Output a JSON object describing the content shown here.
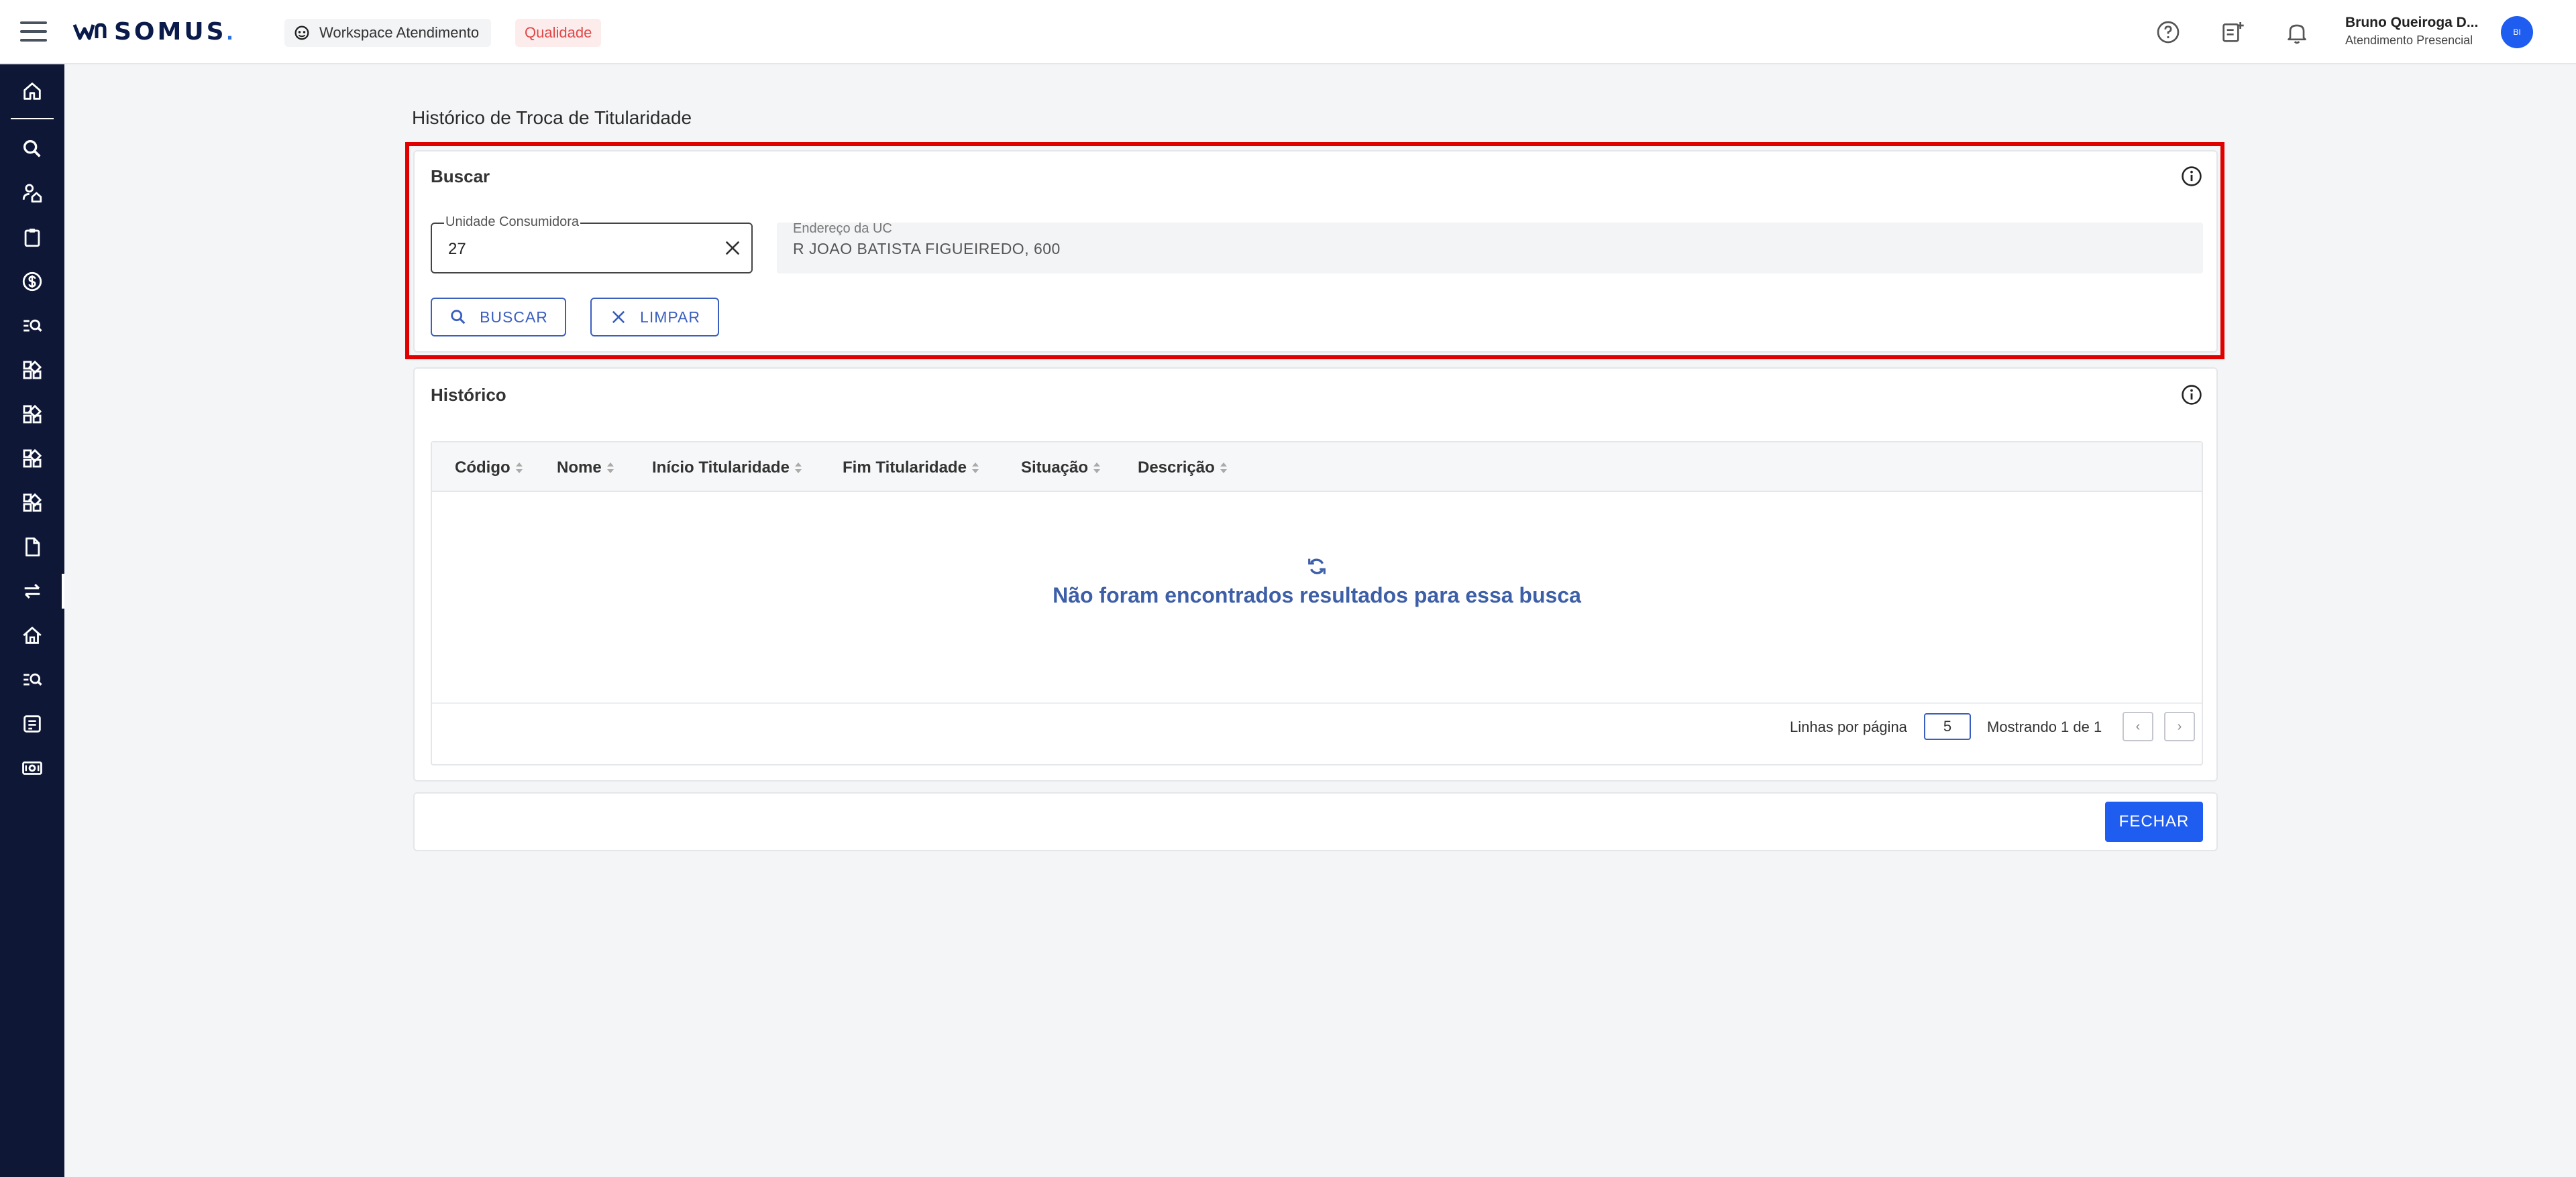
{
  "header": {
    "brand": "SOMUS",
    "brand_dot": ".",
    "workspace_label": "Workspace Atendimento",
    "environment_badge": "Qualidade",
    "user_name": "Bruno Queiroga D...",
    "user_role": "Atendimento Presencial",
    "avatar_initials": "BI"
  },
  "page": {
    "title": "Histórico de Troca de Titularidade"
  },
  "search": {
    "title": "Buscar",
    "uc_label": "Unidade Consumidora",
    "uc_value": "27",
    "address_label": "Endereço da UC",
    "address_value": "R JOAO BATISTA FIGUEIREDO, 600",
    "search_button": "BUSCAR",
    "clear_button": "LIMPAR"
  },
  "history": {
    "title": "Histórico",
    "columns": [
      "Código",
      "Nome",
      "Início Titularidade",
      "Fim Titularidade",
      "Situação",
      "Descrição"
    ],
    "empty_message": "Não foram encontrados resultados para essa busca",
    "rows_per_page_label": "Linhas por página",
    "rows_per_page_value": "5",
    "showing_text": "Mostrando 1 de 1",
    "prev_label": "‹",
    "next_label": "›"
  },
  "footer": {
    "close_button": "FECHAR"
  },
  "colors": {
    "sidebar_bg": "#0e1736",
    "primary": "#1f5df0",
    "accent_outline": "#3a5fbf",
    "highlight": "#e00000",
    "badge_text": "#e04848"
  },
  "sidebar": {
    "items": [
      "home-icon",
      "search-icon",
      "user-home-icon",
      "clipboard-icon",
      "dollar-icon",
      "list-search-icon",
      "apps-icon",
      "apps-icon",
      "apps-icon",
      "apps-icon",
      "document-icon",
      "swap-icon",
      "house-icon",
      "list-search-icon",
      "notes-icon",
      "cash-icon"
    ],
    "active_index": 11
  }
}
